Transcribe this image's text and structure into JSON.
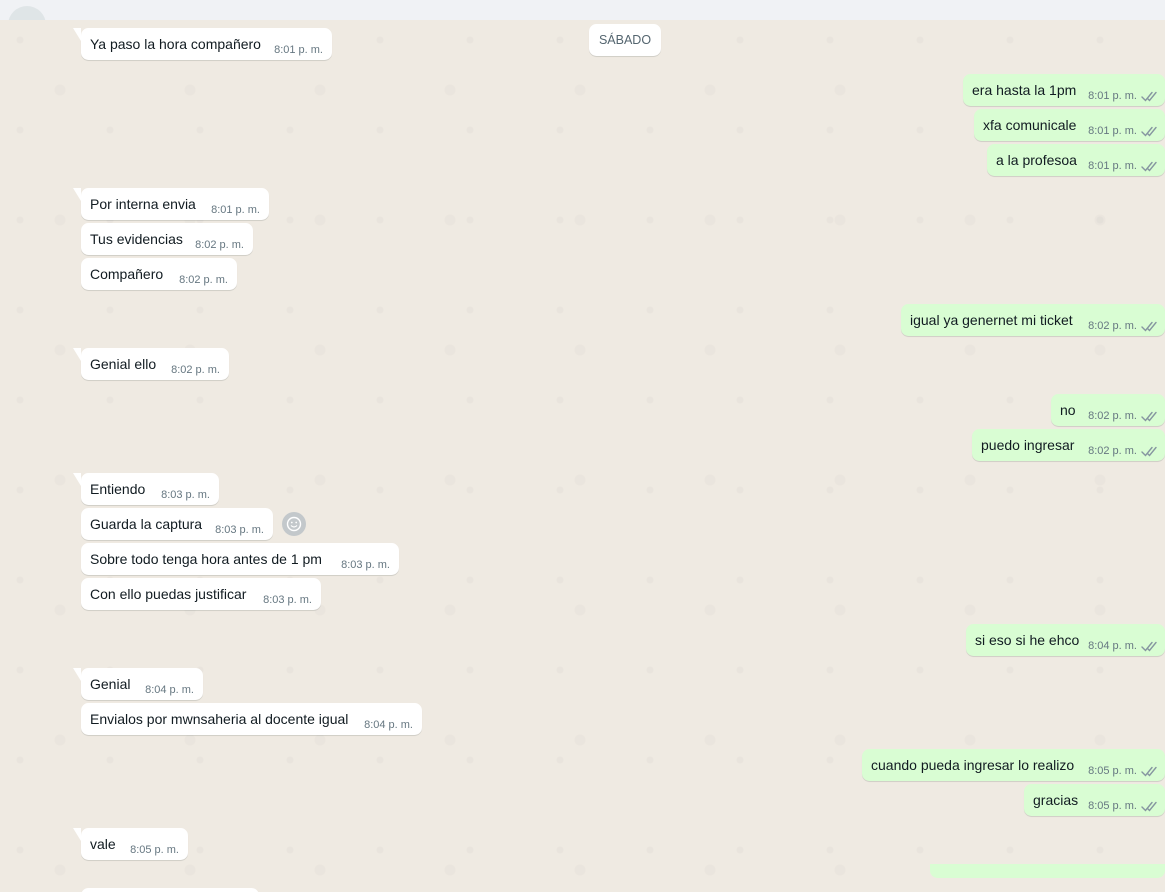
{
  "date_separator": "SÁBADO",
  "messages": [
    {
      "dir": "in",
      "text": "Ya paso la hora compañero",
      "time": "8:01 p. m."
    },
    {
      "dir": "out",
      "text": "era hasta la 1pm",
      "time": "8:01 p. m."
    },
    {
      "dir": "out",
      "text": "xfa comunicale",
      "time": "8:01 p. m."
    },
    {
      "dir": "out",
      "text": "a la profesoa",
      "time": "8:01 p. m."
    },
    {
      "dir": "in",
      "text": "Por interna envia",
      "time": "8:01 p. m."
    },
    {
      "dir": "in",
      "text": "Tus evidencias",
      "time": "8:02 p. m."
    },
    {
      "dir": "in",
      "text": "Compañero",
      "time": "8:02 p. m."
    },
    {
      "dir": "out",
      "text": "igual ya genernet mi ticket",
      "time": "8:02 p. m."
    },
    {
      "dir": "in",
      "text": "Genial ello",
      "time": "8:02 p. m."
    },
    {
      "dir": "out",
      "text": "no",
      "time": "8:02 p. m."
    },
    {
      "dir": "out",
      "text": "puedo ingresar",
      "time": "8:02 p. m."
    },
    {
      "dir": "in",
      "text": "Entiendo",
      "time": "8:03 p. m."
    },
    {
      "dir": "in",
      "text": "Guarda la captura",
      "time": "8:03 p. m."
    },
    {
      "dir": "in",
      "text": "Sobre todo tenga hora antes de 1 pm",
      "time": "8:03 p. m."
    },
    {
      "dir": "in",
      "text": "Con ello puedas justificar",
      "time": "8:03 p. m."
    },
    {
      "dir": "out",
      "text": "si eso si he ehco",
      "time": "8:04 p. m."
    },
    {
      "dir": "in",
      "text": "Genial",
      "time": "8:04 p. m."
    },
    {
      "dir": "in",
      "text": "Envialos por mwnsaheria al docente igual",
      "time": "8:04 p. m."
    },
    {
      "dir": "out",
      "text": "cuando pueda ingresar lo realizo",
      "time": "8:05 p. m."
    },
    {
      "dir": "out",
      "text": "gracias",
      "time": "8:05 p. m."
    },
    {
      "dir": "in",
      "text": "vale",
      "time": "8:05 p. m."
    }
  ],
  "colors": {
    "chat_bg": "#efeae2",
    "incoming": "#ffffff",
    "outgoing": "#d9fdd3",
    "time": "#667781",
    "read_ticks": "#8696a0"
  },
  "icons": {
    "read_receipt": "double-check-icon",
    "reaction": "emoji-reaction-icon"
  }
}
